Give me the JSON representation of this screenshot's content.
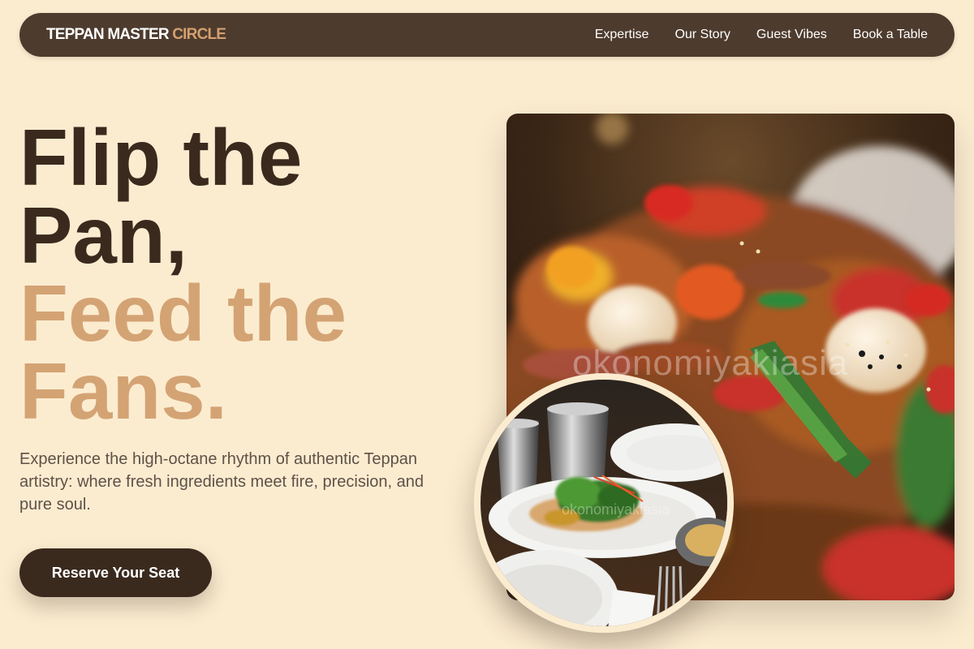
{
  "brand": {
    "name_main": "TEPPAN MASTER",
    "name_accent": "CIRCLE"
  },
  "nav": {
    "links": [
      {
        "label": "Expertise"
      },
      {
        "label": "Our Story"
      },
      {
        "label": "Guest Vibes"
      },
      {
        "label": "Book a Table"
      }
    ]
  },
  "hero": {
    "headline_lines": [
      "Flip the",
      "Pan,",
      "Feed the",
      "Fans."
    ],
    "description": "Experience the high-octane rhythm of authentic Teppan artistry: where fresh ingredients meet fire, precision, and pure soul.",
    "cta_label": "Reserve Your Seat"
  },
  "images": {
    "main": {
      "subject": "stir-fried vegetables and quail eggs on teppan",
      "watermark": "okonomiyakiasia"
    },
    "inset": {
      "subject": "plated salad with cups on wooden table",
      "watermark": "okonomiyakiasia"
    }
  },
  "colors": {
    "background": "#fbecd0",
    "nav_bg": "#4d3b2e",
    "text_dark": "#3a2a1e",
    "accent": "#d4a374",
    "body_text": "#5f5147"
  }
}
